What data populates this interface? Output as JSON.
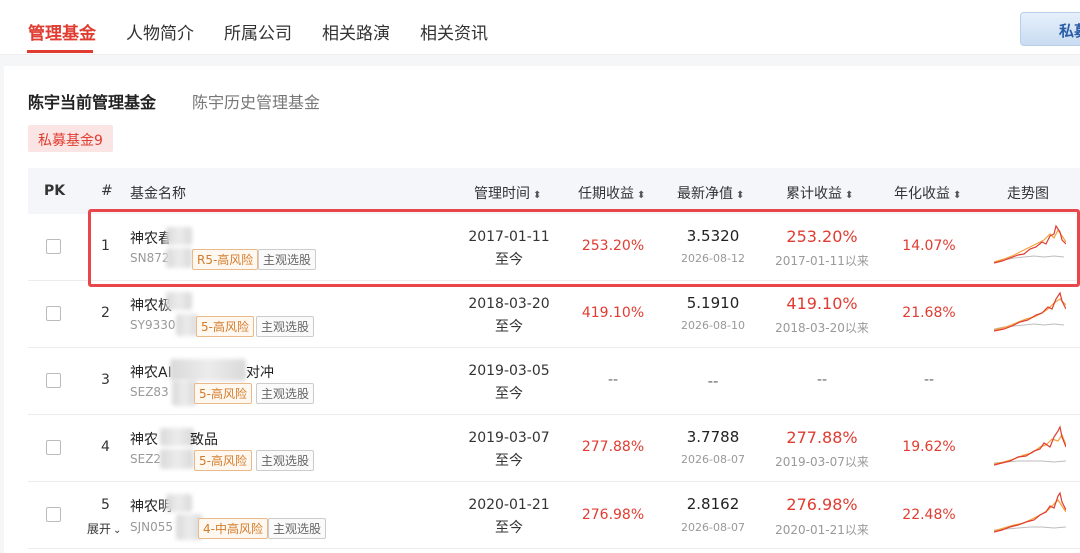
{
  "nav_tabs": [
    "管理基金",
    "人物简介",
    "所属公司",
    "相关路演",
    "相关资讯"
  ],
  "top_button": "私募",
  "sub_tabs": [
    "陈宇当前管理基金",
    "陈宇历史管理基金"
  ],
  "fund_type_pill": "私募基金9",
  "table": {
    "headers": {
      "pk": "PK",
      "index": "#",
      "name": "基金名称",
      "mgmt_time": "管理时间",
      "term_return": "任期收益",
      "latest_nav": "最新净值",
      "cum_return": "累计收益",
      "annual_return": "年化收益",
      "trend": "走势图"
    },
    "sort_glyph": "⬍",
    "rows": [
      {
        "index": "1",
        "name": "神农春",
        "code": "SN872",
        "risk": "R5-高风险",
        "style": "主观选股",
        "mgmt_date": "2017-01-11",
        "mgmt_to": "至今",
        "term_return": "253.20%",
        "nav": "3.5320",
        "nav_date": "2026-08-12",
        "cum_return": "253.20%",
        "cum_since": "2017-01-11以来",
        "annual": "14.07%"
      },
      {
        "index": "2",
        "name": "神农极",
        "code": "SY9330",
        "risk": "5-高风险",
        "style": "主观选股",
        "mgmt_date": "2018-03-20",
        "mgmt_to": "至今",
        "term_return": "419.10%",
        "nav": "5.1910",
        "nav_date": "2026-08-10",
        "cum_return": "419.10%",
        "cum_since": "2018-03-20以来",
        "annual": "21.68%"
      },
      {
        "index": "3",
        "name": "神农AI",
        "name_suffix": "对冲",
        "code": "SEZ83",
        "risk": "5-高风险",
        "style": "主观选股",
        "mgmt_date": "2019-03-05",
        "mgmt_to": "至今",
        "term_return": "--",
        "nav": "--",
        "nav_date": "",
        "cum_return": "--",
        "cum_since": "",
        "annual": "--"
      },
      {
        "index": "4",
        "name": "神农",
        "name_suffix": "致品",
        "code": "SEZ2",
        "risk": "5-高风险",
        "style": "主观选股",
        "mgmt_date": "2019-03-07",
        "mgmt_to": "至今",
        "term_return": "277.88%",
        "nav": "3.7788",
        "nav_date": "2026-08-07",
        "cum_return": "277.88%",
        "cum_since": "2019-03-07以来",
        "annual": "19.62%"
      },
      {
        "index": "5",
        "name": "神农明",
        "code": "SJN055",
        "risk": "4-中高风险",
        "style": "主观选股",
        "mgmt_date": "2020-01-21",
        "mgmt_to": "至今",
        "term_return": "276.98%",
        "nav": "2.8162",
        "nav_date": "2026-08-07",
        "cum_return": "276.98%",
        "cum_since": "2020-01-21以来",
        "annual": "22.48%"
      }
    ],
    "expand_label": "展开",
    "expand_icon": "chevron-down-icon"
  },
  "colors": {
    "accent": "#e03c31",
    "highlight_border": "#e8464b",
    "trend_fund": "#e03c31",
    "trend_fund_alt": "#f3a23a",
    "trend_benchmark": "#bdbdbd"
  }
}
